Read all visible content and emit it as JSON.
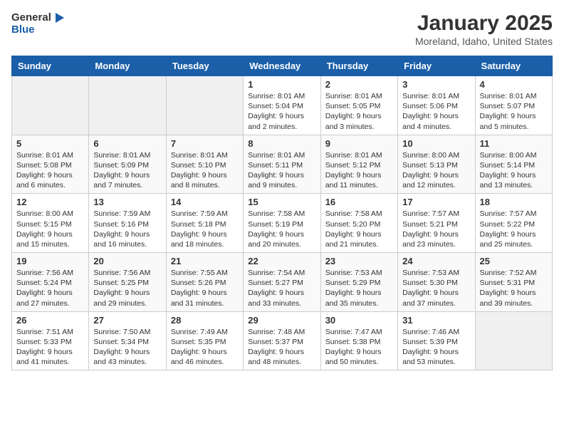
{
  "header": {
    "logo_general": "General",
    "logo_blue": "Blue",
    "title": "January 2025",
    "subtitle": "Moreland, Idaho, United States"
  },
  "days_of_week": [
    "Sunday",
    "Monday",
    "Tuesday",
    "Wednesday",
    "Thursday",
    "Friday",
    "Saturday"
  ],
  "weeks": [
    [
      {
        "day": "",
        "empty": true
      },
      {
        "day": "",
        "empty": true
      },
      {
        "day": "",
        "empty": true
      },
      {
        "day": "1",
        "sunrise": "8:01 AM",
        "sunset": "5:04 PM",
        "daylight": "9 hours and 2 minutes."
      },
      {
        "day": "2",
        "sunrise": "8:01 AM",
        "sunset": "5:05 PM",
        "daylight": "9 hours and 3 minutes."
      },
      {
        "day": "3",
        "sunrise": "8:01 AM",
        "sunset": "5:06 PM",
        "daylight": "9 hours and 4 minutes."
      },
      {
        "day": "4",
        "sunrise": "8:01 AM",
        "sunset": "5:07 PM",
        "daylight": "9 hours and 5 minutes."
      }
    ],
    [
      {
        "day": "5",
        "sunrise": "8:01 AM",
        "sunset": "5:08 PM",
        "daylight": "9 hours and 6 minutes."
      },
      {
        "day": "6",
        "sunrise": "8:01 AM",
        "sunset": "5:09 PM",
        "daylight": "9 hours and 7 minutes."
      },
      {
        "day": "7",
        "sunrise": "8:01 AM",
        "sunset": "5:10 PM",
        "daylight": "9 hours and 8 minutes."
      },
      {
        "day": "8",
        "sunrise": "8:01 AM",
        "sunset": "5:11 PM",
        "daylight": "9 hours and 9 minutes."
      },
      {
        "day": "9",
        "sunrise": "8:01 AM",
        "sunset": "5:12 PM",
        "daylight": "9 hours and 11 minutes."
      },
      {
        "day": "10",
        "sunrise": "8:00 AM",
        "sunset": "5:13 PM",
        "daylight": "9 hours and 12 minutes."
      },
      {
        "day": "11",
        "sunrise": "8:00 AM",
        "sunset": "5:14 PM",
        "daylight": "9 hours and 13 minutes."
      }
    ],
    [
      {
        "day": "12",
        "sunrise": "8:00 AM",
        "sunset": "5:15 PM",
        "daylight": "9 hours and 15 minutes."
      },
      {
        "day": "13",
        "sunrise": "7:59 AM",
        "sunset": "5:16 PM",
        "daylight": "9 hours and 16 minutes."
      },
      {
        "day": "14",
        "sunrise": "7:59 AM",
        "sunset": "5:18 PM",
        "daylight": "9 hours and 18 minutes."
      },
      {
        "day": "15",
        "sunrise": "7:58 AM",
        "sunset": "5:19 PM",
        "daylight": "9 hours and 20 minutes."
      },
      {
        "day": "16",
        "sunrise": "7:58 AM",
        "sunset": "5:20 PM",
        "daylight": "9 hours and 21 minutes."
      },
      {
        "day": "17",
        "sunrise": "7:57 AM",
        "sunset": "5:21 PM",
        "daylight": "9 hours and 23 minutes."
      },
      {
        "day": "18",
        "sunrise": "7:57 AM",
        "sunset": "5:22 PM",
        "daylight": "9 hours and 25 minutes."
      }
    ],
    [
      {
        "day": "19",
        "sunrise": "7:56 AM",
        "sunset": "5:24 PM",
        "daylight": "9 hours and 27 minutes."
      },
      {
        "day": "20",
        "sunrise": "7:56 AM",
        "sunset": "5:25 PM",
        "daylight": "9 hours and 29 minutes."
      },
      {
        "day": "21",
        "sunrise": "7:55 AM",
        "sunset": "5:26 PM",
        "daylight": "9 hours and 31 minutes."
      },
      {
        "day": "22",
        "sunrise": "7:54 AM",
        "sunset": "5:27 PM",
        "daylight": "9 hours and 33 minutes."
      },
      {
        "day": "23",
        "sunrise": "7:53 AM",
        "sunset": "5:29 PM",
        "daylight": "9 hours and 35 minutes."
      },
      {
        "day": "24",
        "sunrise": "7:53 AM",
        "sunset": "5:30 PM",
        "daylight": "9 hours and 37 minutes."
      },
      {
        "day": "25",
        "sunrise": "7:52 AM",
        "sunset": "5:31 PM",
        "daylight": "9 hours and 39 minutes."
      }
    ],
    [
      {
        "day": "26",
        "sunrise": "7:51 AM",
        "sunset": "5:33 PM",
        "daylight": "9 hours and 41 minutes."
      },
      {
        "day": "27",
        "sunrise": "7:50 AM",
        "sunset": "5:34 PM",
        "daylight": "9 hours and 43 minutes."
      },
      {
        "day": "28",
        "sunrise": "7:49 AM",
        "sunset": "5:35 PM",
        "daylight": "9 hours and 46 minutes."
      },
      {
        "day": "29",
        "sunrise": "7:48 AM",
        "sunset": "5:37 PM",
        "daylight": "9 hours and 48 minutes."
      },
      {
        "day": "30",
        "sunrise": "7:47 AM",
        "sunset": "5:38 PM",
        "daylight": "9 hours and 50 minutes."
      },
      {
        "day": "31",
        "sunrise": "7:46 AM",
        "sunset": "5:39 PM",
        "daylight": "9 hours and 53 minutes."
      },
      {
        "day": "",
        "empty": true
      }
    ]
  ]
}
